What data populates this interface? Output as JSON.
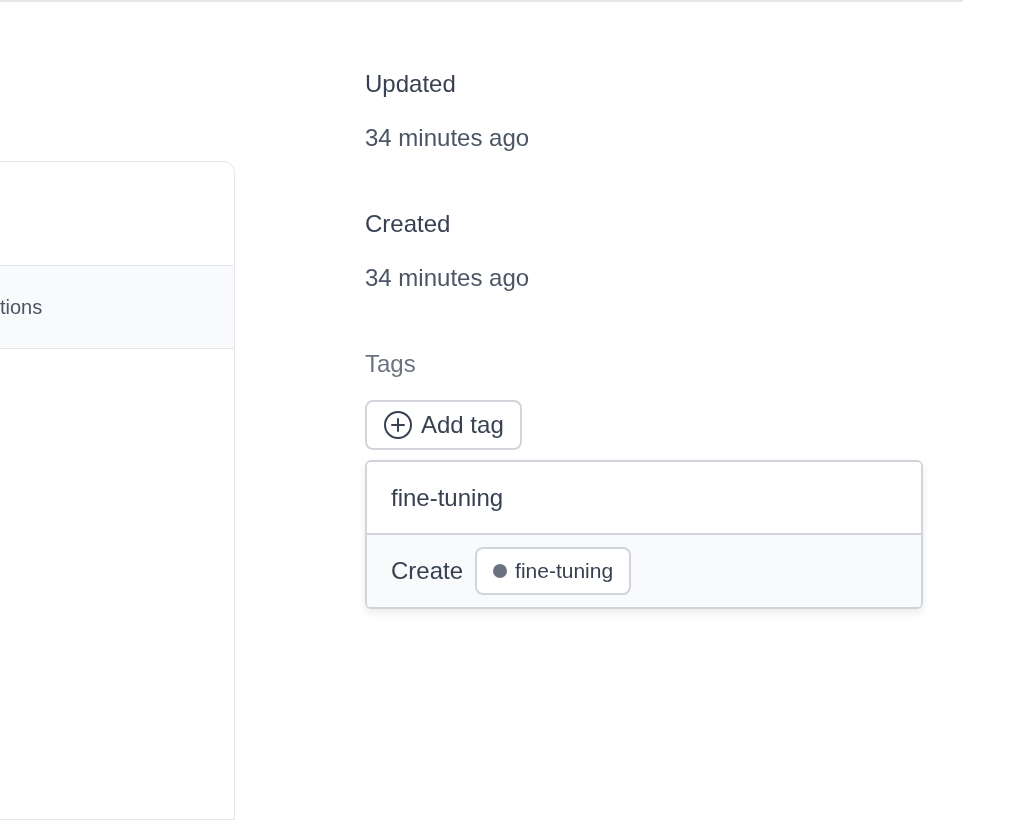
{
  "left_panel": {
    "rows": [
      {
        "label": "tions"
      }
    ]
  },
  "details": [
    {
      "label": "Updated",
      "value": "34 minutes ago"
    },
    {
      "label": "Created",
      "value": "34 minutes ago"
    }
  ],
  "tags": {
    "label": "Tags",
    "add_button": "Add tag",
    "search": {
      "value": "fine-tuning"
    },
    "create": {
      "label": "Create",
      "tag": "fine-tuning",
      "color": "#6b7280"
    }
  }
}
